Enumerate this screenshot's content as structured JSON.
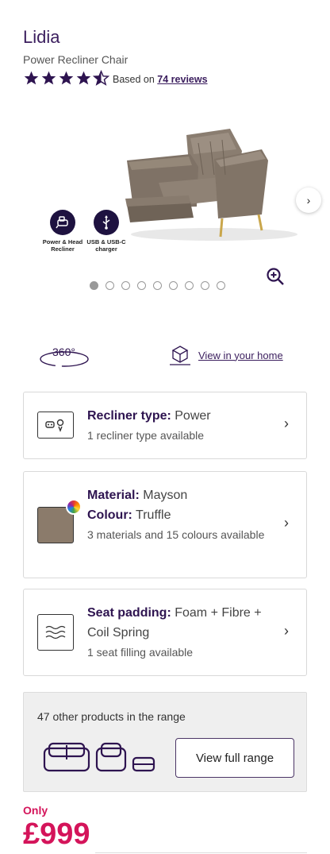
{
  "product": {
    "name": "Lidia",
    "subtitle": "Power Recliner Chair",
    "rating": 4.5,
    "reviews_prefix": "Based on ",
    "reviews_link": "74 reviews"
  },
  "gallery": {
    "features": [
      {
        "icon": "power-head-recliner-icon",
        "label": "Power & Head Recliner"
      },
      {
        "icon": "usb-icon",
        "label": "USB & USB-C charger"
      }
    ],
    "dots_count": 9,
    "active_dot": 0
  },
  "view360": {
    "label": "360°"
  },
  "view_home": {
    "label": "View in your home"
  },
  "options": [
    {
      "key": "recliner",
      "title": "Recliner type:",
      "value": " Power",
      "sub": "1 recliner type available",
      "icon": "recliner-type-icon"
    },
    {
      "key": "material",
      "title": "Material:",
      "value": " Mayson",
      "title2": "Colour:",
      "value2": " Truffle",
      "sub": "3 materials and 15 colours available",
      "icon": "fabric-swatch-icon",
      "swatch_color": "#8b7b6b"
    },
    {
      "key": "padding",
      "title": "Seat padding:",
      "value": " Foam + Fibre + Coil Spring",
      "sub": "1 seat filling available",
      "icon": "seat-padding-icon"
    }
  ],
  "range": {
    "text": "47 other products in the range",
    "button": "View full range"
  },
  "price": {
    "only": "Only",
    "amount": "£999",
    "color": "#d4145a"
  },
  "colors": {
    "brand": "#3b1e5e",
    "accent": "#d4145a"
  }
}
